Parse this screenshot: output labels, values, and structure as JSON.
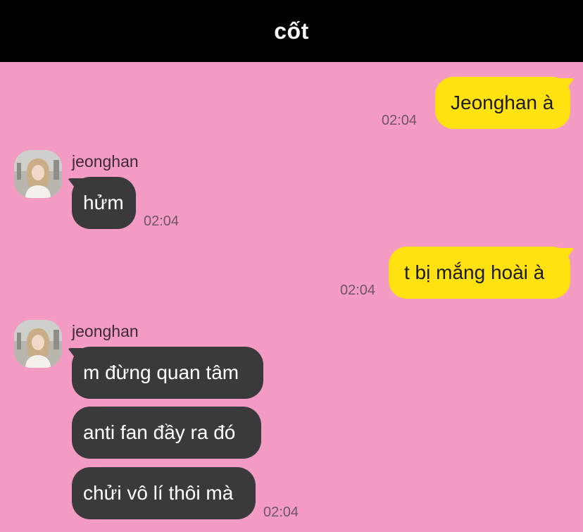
{
  "header": {
    "title": "cốt"
  },
  "messages": [
    {
      "side": "outgoing",
      "text": "Jeonghan à",
      "time": "02:04"
    },
    {
      "side": "incoming",
      "sender": "jeonghan",
      "text": "hửm",
      "time": "02:04"
    },
    {
      "side": "outgoing",
      "text": "t bị mắng hoài à",
      "time": "02:04"
    },
    {
      "side": "incoming",
      "sender": "jeonghan",
      "texts": [
        "m đừng quan tâm",
        "anti fan đầy ra đó",
        "chửi vô lí thôi mà"
      ],
      "time": "02:04"
    }
  ],
  "colors": {
    "background": "#f39bc3",
    "header": "#000000",
    "outgoing_bubble": "#ffe20f",
    "incoming_bubble": "#3a3a3c"
  }
}
